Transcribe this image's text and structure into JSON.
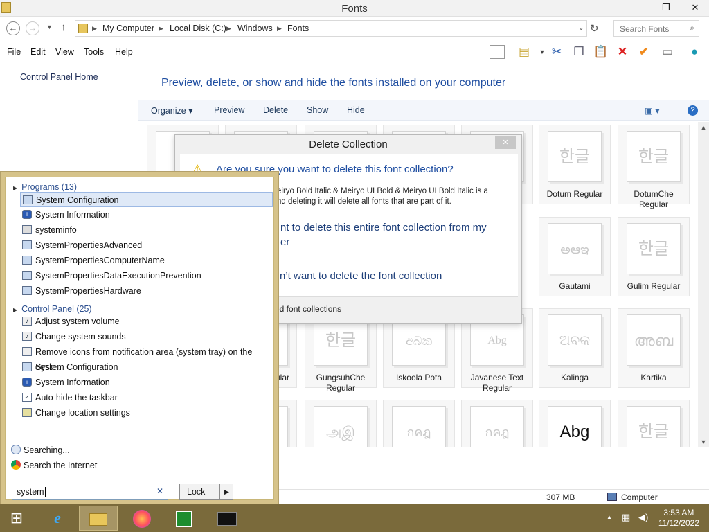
{
  "window": {
    "title": "Fonts",
    "min": "–",
    "max": "❐",
    "close": "✕"
  },
  "address": {
    "crumbs": [
      "My Computer",
      "Local Disk (C:)",
      "Windows",
      "Fonts"
    ],
    "search_placeholder": "Search Fonts"
  },
  "menu": [
    "File",
    "Edit",
    "View",
    "Tools",
    "Help"
  ],
  "sidebar": {
    "link": "Control Panel Home"
  },
  "main": {
    "heading": "Preview, delete, or show and hide the fonts installed on your computer"
  },
  "commands": [
    "Organize ▾",
    "Preview",
    "Delete",
    "Show",
    "Hide"
  ],
  "tiles": [
    {
      "name": "Dotum Regular",
      "glyph": "한글"
    },
    {
      "name": "DotumChe Regular",
      "glyph": "한글"
    },
    {
      "name": "Gautami",
      "glyph": "అఆఇ"
    },
    {
      "name": "Gulim Regular",
      "glyph": "한글"
    },
    {
      "name": "gular",
      "glyph": ""
    },
    {
      "name": "GungsuhChe Regular",
      "glyph": "한글"
    },
    {
      "name": "Iskoola Pota",
      "glyph": "අබක"
    },
    {
      "name": "Javanese Text Regular",
      "glyph": "Abg"
    },
    {
      "name": "Kalinga",
      "glyph": "ଅବକ"
    },
    {
      "name": "Kartika",
      "glyph": "അബ"
    },
    {
      "name": "",
      "glyph": "அஇ"
    },
    {
      "name": "",
      "glyph": "กคฎ"
    },
    {
      "name": "",
      "glyph": "กคฎ"
    },
    {
      "name": "",
      "glyph": "Abg"
    },
    {
      "name": "",
      "glyph": "한글"
    }
  ],
  "status": {
    "size": "307 MB",
    "location": "Computer"
  },
  "dialog": {
    "title": "Delete Collection",
    "question": "Are you sure you want to delete this font collection?",
    "body_line1": "eiryo Bold Italic & Meiryo UI Bold & Meiryo UI Bold Italic is a",
    "body_line2": "nd deleting it will delete all fonts that are part of it.",
    "opt_yes_line1": "nt to delete this entire font collection from my",
    "opt_yes_line2": "er",
    "opt_no": "n’t want to delete the font collection",
    "footer": "ed font collections",
    "close": "✕"
  },
  "start": {
    "programs_header": "Programs (13)",
    "programs": [
      "System Configuration",
      "System Information",
      "systeminfo",
      "SystemPropertiesAdvanced",
      "SystemPropertiesComputerName",
      "SystemPropertiesDataExecutionPrevention",
      "SystemPropertiesHardware"
    ],
    "cp_header": "Control Panel (25)",
    "control_panel": [
      "Adjust system volume",
      "Change system sounds",
      "Remove icons from notification area (system tray) on the desk...",
      "System Configuration",
      "System Information",
      "Auto-hide the taskbar",
      "Change location settings"
    ],
    "searching": "Searching...",
    "search_internet": "Search the Internet",
    "query": "system",
    "lock": "Lock"
  },
  "clock": {
    "time": "3:53 AM",
    "date": "11/12/2022"
  },
  "colors": {
    "taskbar": "#7a6a3b",
    "start_border": "#d6c38a",
    "link_blue": "#1f4ea1"
  }
}
